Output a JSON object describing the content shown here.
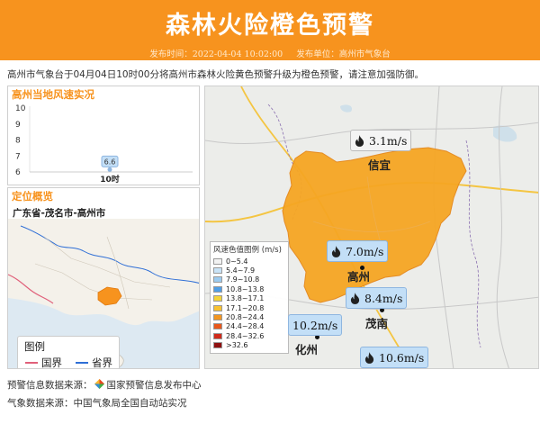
{
  "header": {
    "title": "森林火险橙色预警",
    "publish_time_label": "发布时间：2022-04-04 10:02:00",
    "publisher_label": "发布单位：高州市气象台"
  },
  "summary": "高州市气象台于04月04日10时00分将高州市森林火险黄色预警升级为橙色预警，请注意加强防御。",
  "wind_panel": {
    "title": "高州当地风速实况",
    "y_ticks": [
      "10",
      "9",
      "8",
      "7",
      "6"
    ],
    "x_label": "10时",
    "point_label": "6.6",
    "chart_data": {
      "type": "scatter",
      "categories": [
        "10时"
      ],
      "values": [
        6.6
      ],
      "ylim": [
        6,
        10
      ]
    }
  },
  "location_panel": {
    "title": "定位概览",
    "subtitle": "广东省-茂名市-高州市",
    "legend": {
      "title": "图例",
      "items": [
        {
          "label": "国界",
          "color": "#e0607a"
        },
        {
          "label": "省界",
          "color": "#2f6fd6"
        }
      ]
    }
  },
  "map_panel": {
    "legend": {
      "title": "风速色值图例 (m/s)",
      "items": [
        {
          "label": "0~5.4",
          "color": "#f2f2f2"
        },
        {
          "label": "5.4~7.9",
          "color": "#c9e3f7"
        },
        {
          "label": "7.9~10.8",
          "color": "#9ccbf0"
        },
        {
          "label": "10.8~13.8",
          "color": "#4f9ee6"
        },
        {
          "label": "13.8~17.1",
          "color": "#f3d33a"
        },
        {
          "label": "17.1~20.8",
          "color": "#f7c233"
        },
        {
          "label": "20.8~24.4",
          "color": "#f29621"
        },
        {
          "label": "24.4~28.4",
          "color": "#e8571c"
        },
        {
          "label": "28.4~32.6",
          "color": "#cf2a1a"
        },
        {
          "label": ">32.6",
          "color": "#8e1010"
        }
      ]
    },
    "stations": [
      {
        "value": "3.1m/s"
      },
      {
        "value": "7.0m/s"
      },
      {
        "value": "8.4m/s"
      },
      {
        "value": "10.2m/s"
      },
      {
        "value": "10.6m/s"
      }
    ],
    "cities": [
      "信宜",
      "高州",
      "茂南",
      "化州"
    ]
  },
  "footer": {
    "warning_source_prefix": "预警信息数据来源：",
    "warning_source_name": "国家预警信息发布中心",
    "weather_source": "气象数据来源：中国气象局全国自动站实况"
  }
}
